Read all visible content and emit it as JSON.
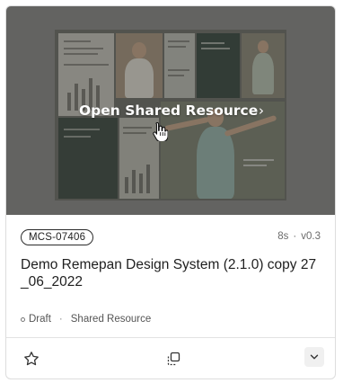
{
  "preview": {
    "action_label": "Open Shared Resource",
    "action_chevron": "›",
    "icons": {
      "cursor": "hand-pointer-icon"
    }
  },
  "resource": {
    "id": "MCS-07406",
    "age": "8s",
    "version": "v0.3",
    "title": "Demo Remepan Design System (2.1.0) copy 27_06_2022",
    "status": "Draft",
    "type": "Shared Resource"
  },
  "footer": {
    "icons": {
      "favorite": "star-icon",
      "duplicate": "duplicate-icon",
      "more": "chevron-down-icon"
    }
  },
  "colors": {
    "overlay": "#3c3c38",
    "border": "#dddddd",
    "text": "#1f1f1f",
    "muted": "#6b6b6b"
  }
}
